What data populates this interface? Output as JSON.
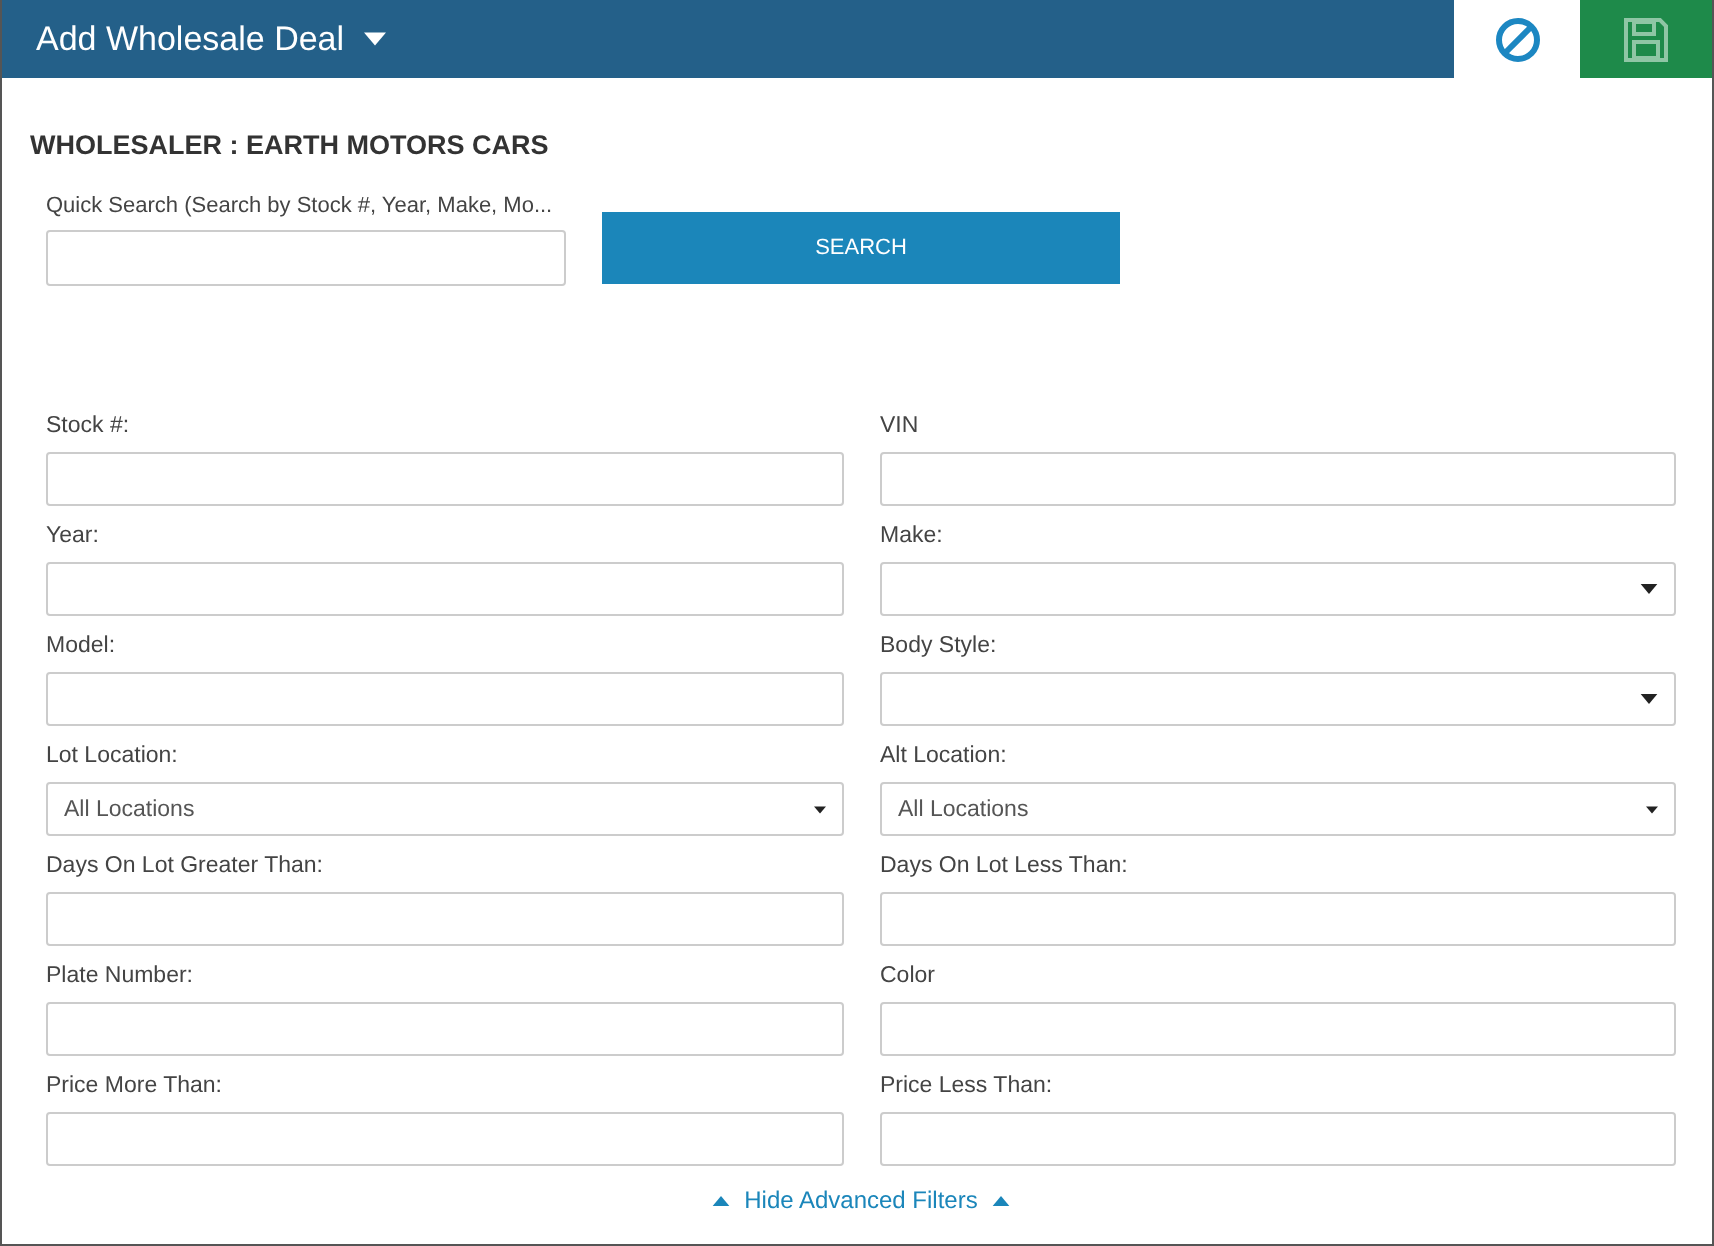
{
  "header": {
    "title": "Add Wholesale Deal"
  },
  "wholesaler": "WHOLESALER : EARTH MOTORS CARS",
  "quick_search": {
    "label": "Quick Search (Search by Stock #, Year, Make, Mo...",
    "button": "SEARCH"
  },
  "fields": [
    {
      "label": "Stock #:",
      "kind": "text"
    },
    {
      "label": "VIN",
      "kind": "text"
    },
    {
      "label": "Year:",
      "kind": "text"
    },
    {
      "label": "Make:",
      "kind": "dropdown"
    },
    {
      "label": "Model:",
      "kind": "text"
    },
    {
      "label": "Body Style:",
      "kind": "dropdown"
    },
    {
      "label": "Lot Location:",
      "kind": "select",
      "value": "All Locations"
    },
    {
      "label": "Alt Location:",
      "kind": "select",
      "value": "All Locations"
    },
    {
      "label": "Days On Lot Greater Than:",
      "kind": "text"
    },
    {
      "label": "Days On Lot Less Than:",
      "kind": "text"
    },
    {
      "label": "Plate Number:",
      "kind": "text"
    },
    {
      "label": "Color",
      "kind": "text"
    },
    {
      "label": "Price More Than:",
      "kind": "text"
    },
    {
      "label": "Price Less Than:",
      "kind": "text"
    }
  ],
  "toggle": "Hide Advanced Filters"
}
